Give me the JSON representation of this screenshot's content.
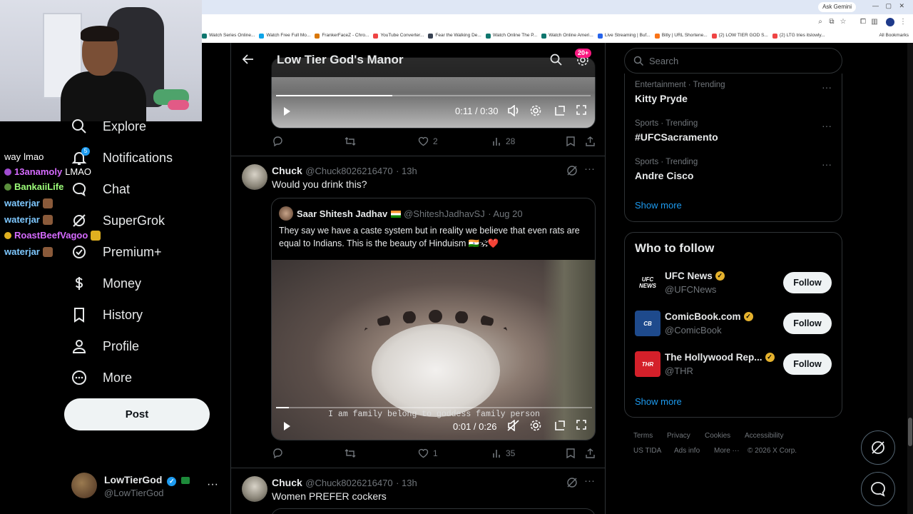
{
  "browser": {
    "ask_button": "Ask Gemini",
    "bookmarks": [
      {
        "label": "Watch Series Online...",
        "color": "#0f766e"
      },
      {
        "label": "Watch Free Full Mo...",
        "color": "#0ea5e9"
      },
      {
        "label": "FrankerFaceZ - Chro...",
        "color": "#d97706"
      },
      {
        "label": "YouTube Converter...",
        "color": "#ef4444"
      },
      {
        "label": "Fear the Walking De...",
        "color": "#374151"
      },
      {
        "label": "Watch Online The P...",
        "color": "#0f766e"
      },
      {
        "label": "Watch Online Ameri...",
        "color": "#0f766e"
      },
      {
        "label": "Live Streaming | Buf...",
        "color": "#2563eb"
      },
      {
        "label": "Bitly | URL Shortene...",
        "color": "#f97316"
      },
      {
        "label": "(2) LOW TIER GOD S...",
        "color": "#ef4444"
      },
      {
        "label": "(2) LTG tries itslowly...",
        "color": "#ef4444"
      }
    ],
    "all_bookmarks": "All Bookmarks"
  },
  "nav": {
    "items": [
      {
        "label": "Explore",
        "icon": "search-icon"
      },
      {
        "label": "Notifications",
        "icon": "bell-icon",
        "badge": "5"
      },
      {
        "label": "Chat",
        "icon": "chat-icon"
      },
      {
        "label": "SuperGrok",
        "icon": "grok-icon"
      },
      {
        "label": "Premium+",
        "icon": "premium-icon"
      },
      {
        "label": "Money",
        "icon": "dollar-icon"
      },
      {
        "label": "History",
        "icon": "bookmark-icon"
      },
      {
        "label": "Profile",
        "icon": "person-icon"
      },
      {
        "label": "More",
        "icon": "more-circle-icon"
      }
    ],
    "post_label": "Post"
  },
  "chat_overlay": [
    {
      "user": "way",
      "text": "lmao",
      "color": "#ffffff"
    },
    {
      "user": "13anamoly",
      "text": "LMAO",
      "color": "#d66bff"
    },
    {
      "user": "BankaiiLife",
      "text": "",
      "color": "#9dff7a"
    },
    {
      "user": "waterjar",
      "text": "",
      "color": "#7ec8ff"
    },
    {
      "user": "waterjar",
      "text": "",
      "color": "#7ec8ff"
    },
    {
      "user": "RoastBeefVagoo",
      "text": "",
      "color": "#d66bff"
    },
    {
      "user": "waterjar",
      "text": "",
      "color": "#7ec8ff"
    }
  ],
  "account": {
    "name": "LowTierGod",
    "handle": "@LowTierGod",
    "more": "···"
  },
  "community": {
    "title": "Low Tier God's Manor",
    "badge": "20+"
  },
  "top_video": {
    "time": "0:11 / 0:30",
    "progress": 0.37,
    "replies": "",
    "reposts": "",
    "likes": "2",
    "views": "28"
  },
  "tweet1": {
    "name": "Chuck",
    "handle": "@Chuck8026216470",
    "time": "· 13h",
    "text": "Would you drink this?",
    "quote": {
      "name": "Saar Shitesh Jadhav",
      "handle": "@ShiteshJadhavSJ",
      "date": "· Aug 20",
      "text": "They say we have a caste system but in reality we believe that even rats are equal to Indians. This is the beauty of Hinduism 🇮🇳🕉❤️",
      "caption": "I am family belong to goddess family person",
      "time": "0:01 / 0:26",
      "progress": 0.04
    },
    "replies": "",
    "reposts": "",
    "likes": "1",
    "views": "35"
  },
  "tweet2": {
    "name": "Chuck",
    "handle": "@Chuck8026216470",
    "time": "· 13h",
    "text": "Women PREFER cockers"
  },
  "search": {
    "placeholder": "Search"
  },
  "trends": [
    {
      "sub": "Entertainment · Trending",
      "name": "Kitty Pryde"
    },
    {
      "sub": "Sports · Trending",
      "name": "#UFCSacramento"
    },
    {
      "sub": "Sports · Trending",
      "name": "Andre Cisco"
    }
  ],
  "trends_show_more": "Show more",
  "who_to_follow": {
    "title": "Who to follow",
    "accounts": [
      {
        "name": "UFC News",
        "handle": "@UFCNews",
        "logo": "UFC NEWS",
        "bg": "#000000",
        "fg": "#ffffff"
      },
      {
        "name": "ComicBook.com",
        "handle": "@ComicBook",
        "logo": "CB",
        "bg": "#1e4a8c",
        "fg": "#ffffff"
      },
      {
        "name": "The Hollywood Rep...",
        "handle": "@THR",
        "logo": "THR",
        "bg": "#d4202a",
        "fg": "#ffffff"
      }
    ],
    "follow_label": "Follow",
    "show_more": "Show more"
  },
  "footer": {
    "row1": [
      "Terms",
      "Privacy",
      "Cookies",
      "Accessibility"
    ],
    "row2": [
      "US TIDA",
      "Ads info",
      "More ···",
      "© 2026 X Corp."
    ]
  }
}
